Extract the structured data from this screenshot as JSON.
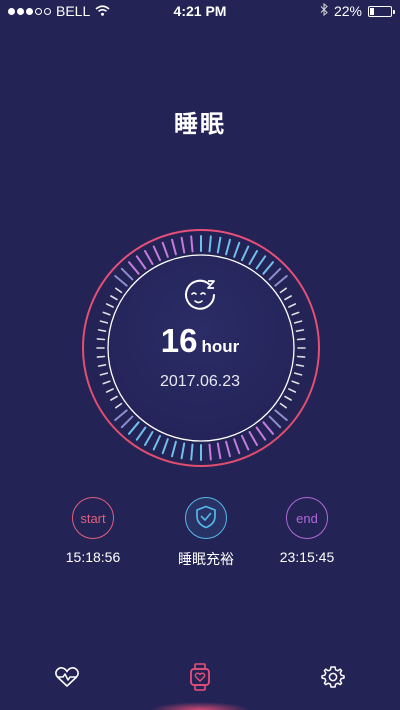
{
  "status_bar": {
    "carrier": "BELL",
    "time": "4:21 PM",
    "battery_percent": "22%",
    "battery_level": 0.22,
    "signal_bars_filled": 3,
    "signal_bars_total": 5
  },
  "header": {
    "title": "睡眠"
  },
  "dial": {
    "hours_value": "16",
    "hours_unit": "hour",
    "date": "2017.06.23",
    "icon": "sleeping-face-icon"
  },
  "stats": {
    "start": {
      "label": "start",
      "time": "15:18:56"
    },
    "quality": {
      "label": "睡眠充裕",
      "icon": "shield-check-icon"
    },
    "end": {
      "label": "end",
      "time": "23:15:45"
    }
  },
  "tabbar": {
    "tabs": [
      {
        "icon": "heart-pulse-icon",
        "active": false
      },
      {
        "icon": "watch-icon",
        "active": true
      },
      {
        "icon": "gear-icon",
        "active": false
      }
    ]
  },
  "colors": {
    "background": "#232355",
    "accent_pink": "#e0607e",
    "accent_purple": "#b06ad8",
    "accent_blue": "#55b8ea"
  }
}
